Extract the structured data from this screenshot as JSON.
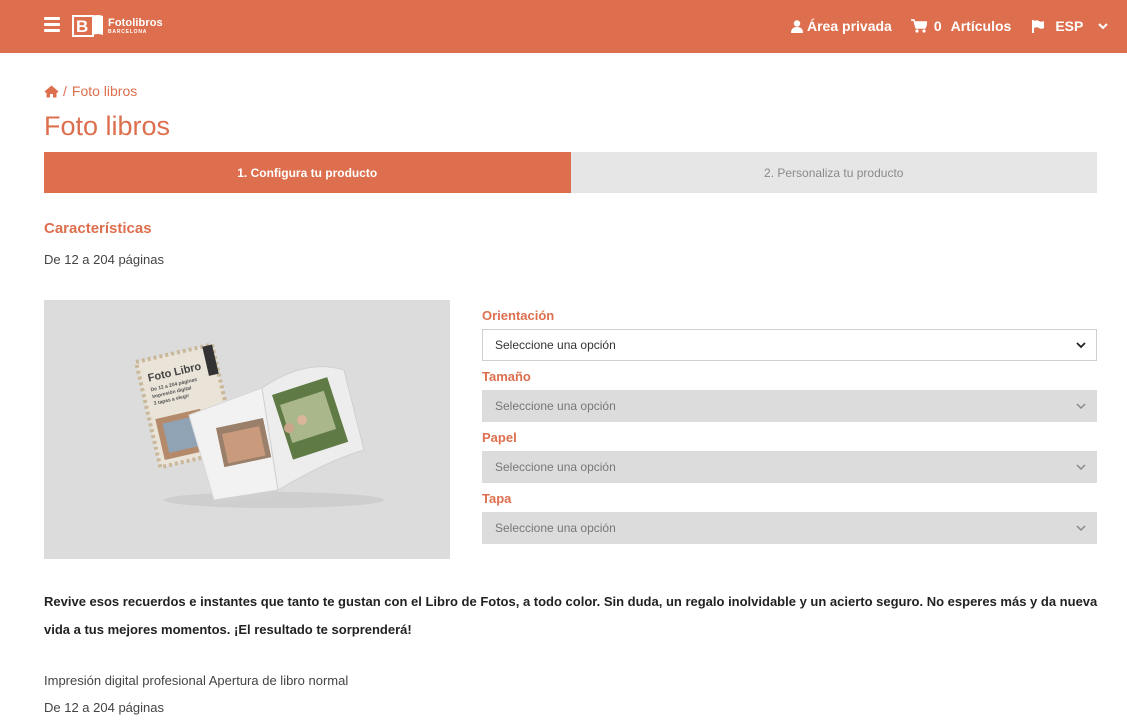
{
  "header": {
    "logo_name": "Fotolibros",
    "logo_sub": "BARCELONA",
    "account_label": "Área privada",
    "cart_count": "0",
    "cart_label": "Artículos",
    "language": "ESP",
    "icons": [
      "menu-icon",
      "user-icon",
      "cart-icon",
      "flag-icon",
      "chevron-down-icon",
      "home-icon"
    ],
    "brand_color": "#dd6f4e"
  },
  "breadcrumb": {
    "separator": "/",
    "current": "Foto libros"
  },
  "page": {
    "title": "Foto libros"
  },
  "steps": [
    {
      "label": "1. Configura tu producto",
      "active": true
    },
    {
      "label": "2. Personaliza tu producto",
      "active": false
    }
  ],
  "features": {
    "title": "Características",
    "subtitle": "De 12 a 204 páginas"
  },
  "product_image": {
    "cover_text": [
      "Foto Libro",
      "De 12 a 204 páginas",
      "Impresión digital",
      "3 tapas a elegir"
    ]
  },
  "form": {
    "fields": [
      {
        "label": "Orientación",
        "value": "Seleccione una opción",
        "enabled": true
      },
      {
        "label": "Tamaño",
        "value": "Seleccione una opción",
        "enabled": false
      },
      {
        "label": "Papel",
        "value": "Seleccione una opción",
        "enabled": false
      },
      {
        "label": "Tapa",
        "value": "Seleccione una opción",
        "enabled": false
      }
    ]
  },
  "description": {
    "text": "Revive esos recuerdos e instantes que tanto te gustan con el Libro de Fotos, a todo color. Sin duda, un regalo inolvidable y un acierto seguro. No esperes más y da nueva vida a tus mejores momentos. ¡El resultado te sorprenderá!",
    "feature_line_1": "Impresión digital profesional Apertura de libro normal",
    "feature_line_2": "De 12 a 204 páginas"
  }
}
